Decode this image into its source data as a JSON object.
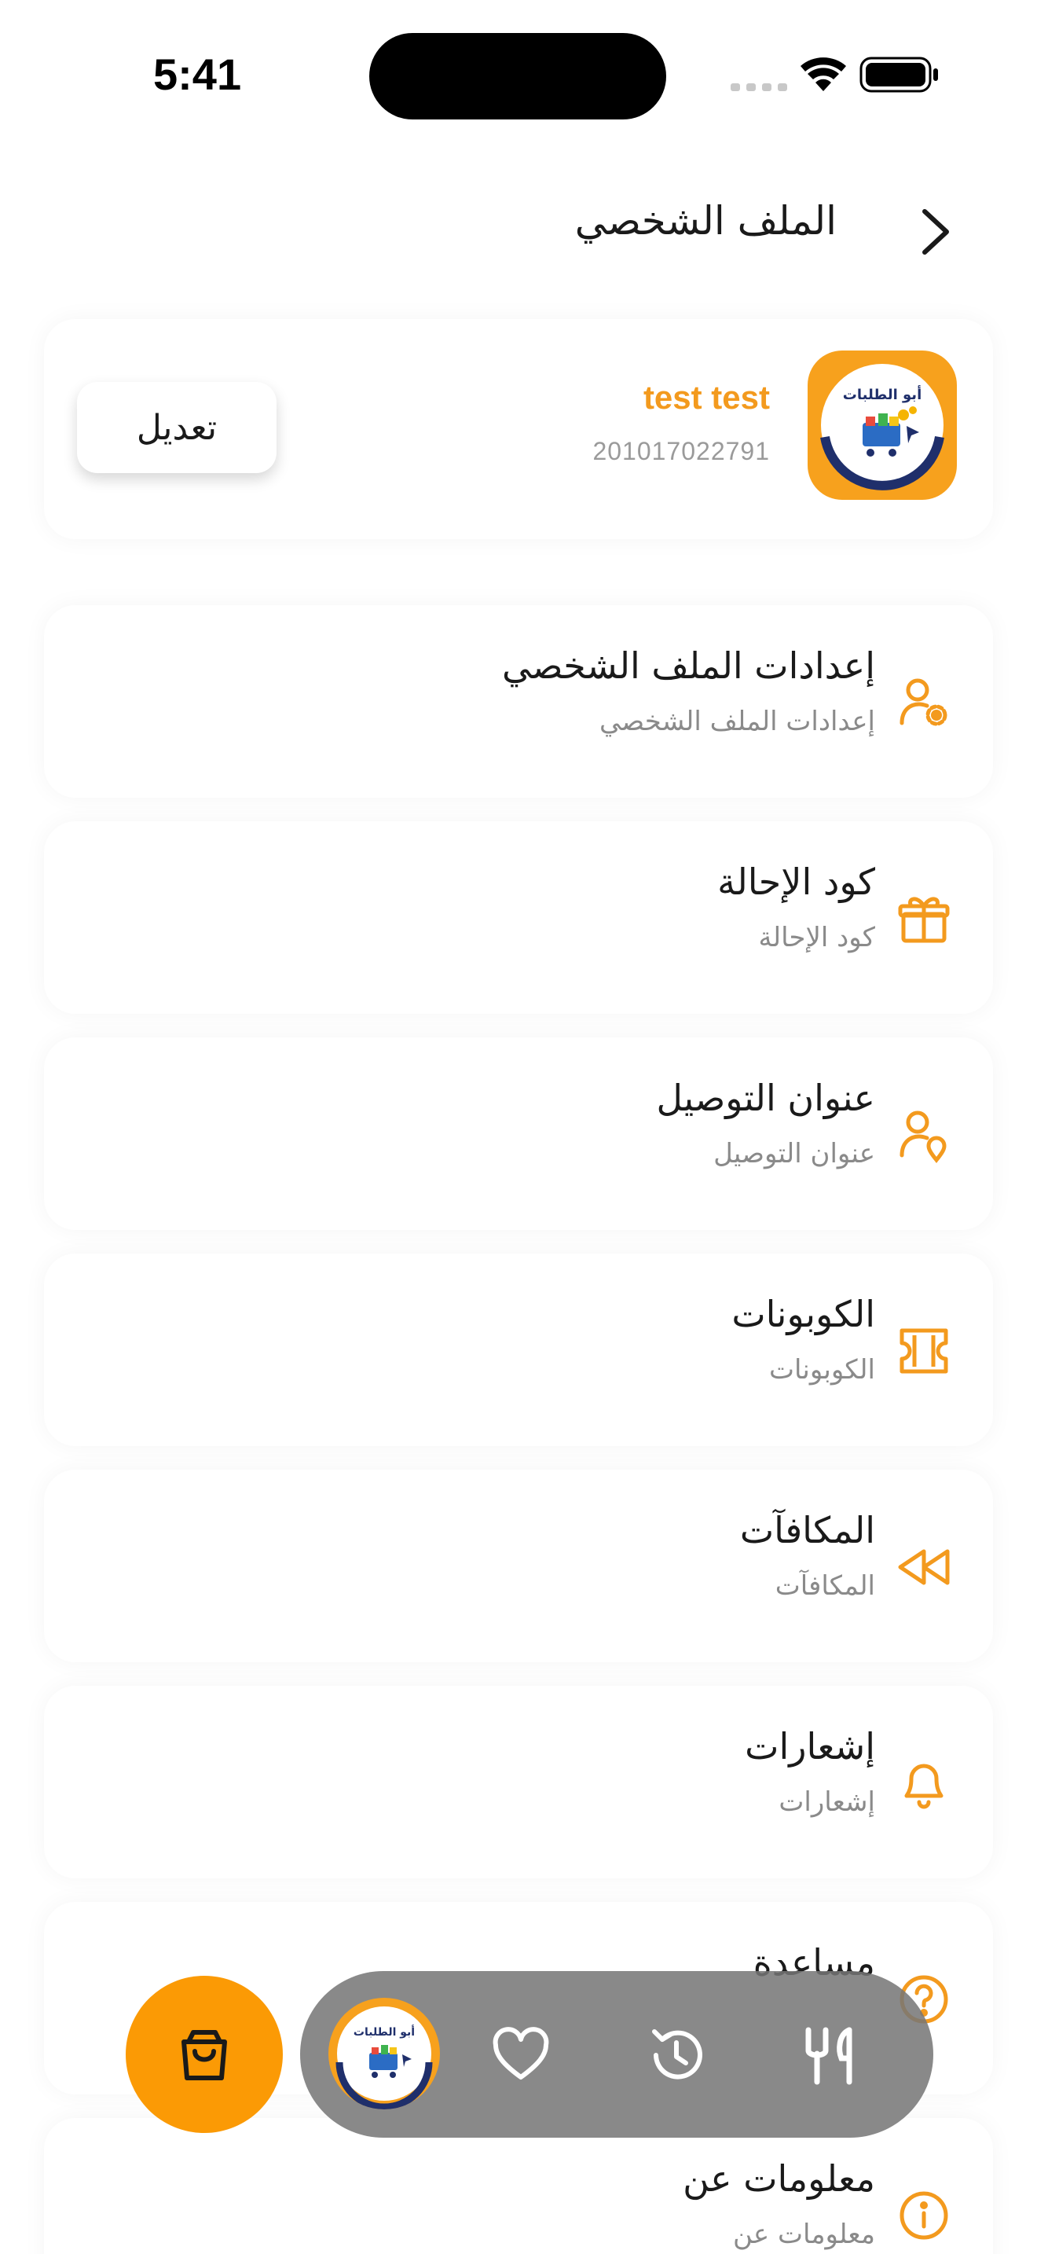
{
  "status_bar": {
    "time": "5:41"
  },
  "header": {
    "title": "الملف الشخصي"
  },
  "profile": {
    "name": "test test",
    "phone": "201017022791",
    "logo_text": "أبو الطلبات",
    "edit_label": "تعديل"
  },
  "menu": [
    {
      "title": "إعدادات الملف الشخصي",
      "subtitle": "إعدادات الملف الشخصي",
      "icon": "user-settings-icon"
    },
    {
      "title": "كود الإحالة",
      "subtitle": "كود الإحالة",
      "icon": "gift-icon"
    },
    {
      "title": "عنوان التوصيل",
      "subtitle": "عنوان التوصيل",
      "icon": "user-location-icon"
    },
    {
      "title": "الكوبونات",
      "subtitle": "الكوبونات",
      "icon": "coupon-icon"
    },
    {
      "title": "المكافآت",
      "subtitle": "المكافآت",
      "icon": "rewind-icon"
    },
    {
      "title": "إشعارات",
      "subtitle": "إشعارات",
      "icon": "bell-icon"
    },
    {
      "title": "مساعدة",
      "subtitle": "",
      "icon": "help-icon"
    },
    {
      "title": "معلومات عن",
      "subtitle": "معلومات عن",
      "icon": "info-icon"
    }
  ],
  "bottom_nav": {
    "items": [
      "cart-icon",
      "home-logo-icon",
      "heart-icon",
      "history-icon",
      "restaurant-icon"
    ],
    "logo_text": "أبو الطلبات"
  },
  "colors": {
    "accent": "#F39A1E",
    "fab": "#FB9A05",
    "nav_pill": "#767676"
  }
}
